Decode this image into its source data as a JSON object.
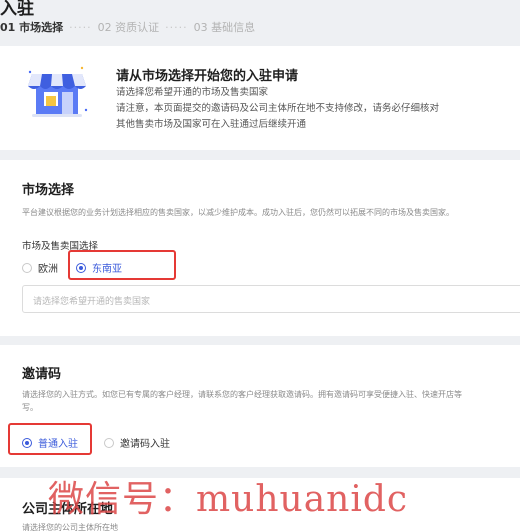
{
  "page": {
    "title": "入驻"
  },
  "steps": [
    {
      "label": "01 市场选择"
    },
    {
      "label": "02 资质认证"
    },
    {
      "label": "03 基础信息"
    }
  ],
  "steps_separator": "·····",
  "intro": {
    "title": "请从市场选择开始您的入驻申请",
    "line1": "请选择您希望开通的市场及售卖国家",
    "line2": "请注意，本页面提交的邀请码及公司主体所在地不支持修改，请务必仔细核对",
    "line3": "其他售卖市场及国家可在入驻通过后继续开通"
  },
  "market": {
    "title": "市场选择",
    "desc": "平台建议根据您的业务计划选择相应的售卖国家，以减少维护成本。成功入驻后，您仍然可以拓展不同的市场及售卖国家。",
    "field_label": "市场及售卖国选择",
    "options": [
      "欧洲",
      "东南亚"
    ],
    "selected": "东南亚",
    "country_placeholder": "请选择您希望开通的售卖国家"
  },
  "invite": {
    "title": "邀请码",
    "desc1": "请选择您的入驻方式。如您已有专属的客户经理，请联系您的客户经理获取邀请码。拥有邀请码可享受便捷入驻、快速开店等",
    "desc2": "写。",
    "options": [
      "普通入驻",
      "邀请码入驻"
    ],
    "selected": "普通入驻"
  },
  "company": {
    "title": "公司主体所在地",
    "desc": "请选择您的公司主体所在地"
  },
  "watermark": "微信号：muhuanidc",
  "colors": {
    "accent": "#3b5bdb",
    "highlight": "#e53935",
    "background": "#eef0f3"
  },
  "icons": {
    "store": "storefront-icon"
  }
}
